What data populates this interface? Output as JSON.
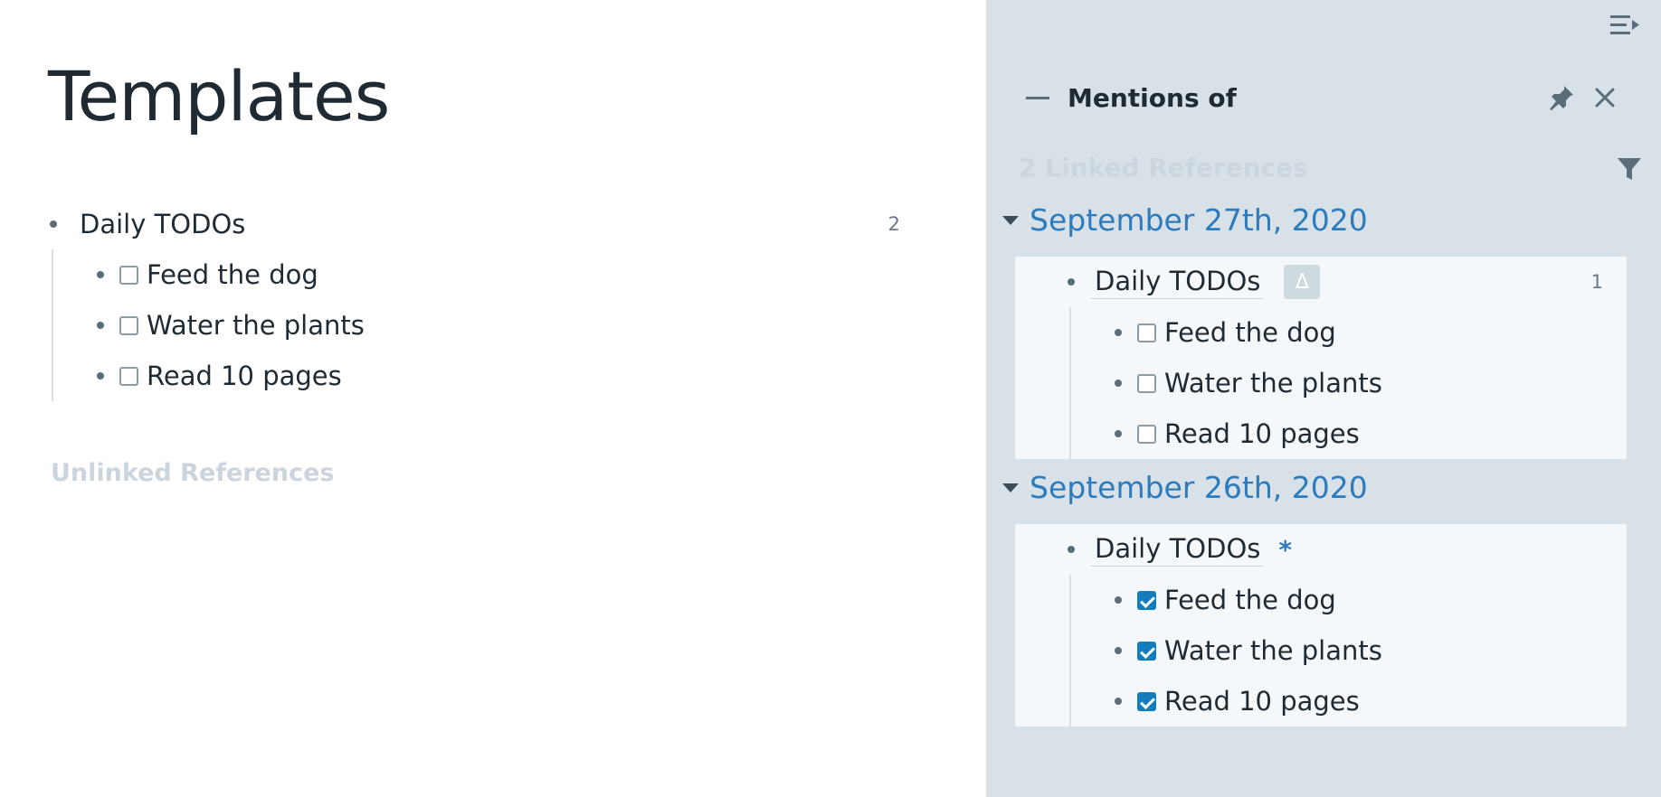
{
  "main": {
    "title": "Templates",
    "parent_block": {
      "text": "Daily TODOs",
      "ref_count": "2"
    },
    "children": [
      {
        "text": "Feed the dog",
        "checked": false
      },
      {
        "text": "Water the plants",
        "checked": false
      },
      {
        "text": "Read 10 pages",
        "checked": false
      }
    ],
    "unlinked_label": "Unlinked References"
  },
  "sidebar": {
    "toggle_icon": "sidebar-toggle-icon",
    "panel": {
      "title": "Mentions of",
      "pin_icon": "pin-icon",
      "close_icon": "close-icon"
    },
    "linked_count": "2 Linked References",
    "groups": [
      {
        "date": "September 27th, 2020",
        "parent_text": "Daily TODOs",
        "badge": "Δ",
        "ref_count": "1",
        "children": [
          {
            "text": "Feed the dog",
            "checked": false
          },
          {
            "text": "Water the plants",
            "checked": false
          },
          {
            "text": "Read 10 pages",
            "checked": false
          }
        ]
      },
      {
        "date": "September 26th, 2020",
        "parent_text": "Daily TODOs",
        "marker": "*",
        "children": [
          {
            "text": "Feed the dog",
            "checked": true
          },
          {
            "text": "Water the plants",
            "checked": true
          },
          {
            "text": "Read 10 pages",
            "checked": true
          }
        ]
      }
    ]
  },
  "colors": {
    "accent": "#137cbd",
    "link": "#2b7bbd",
    "sidebar_bg": "#d8e1e8",
    "card_bg": "#f5f8fa"
  }
}
